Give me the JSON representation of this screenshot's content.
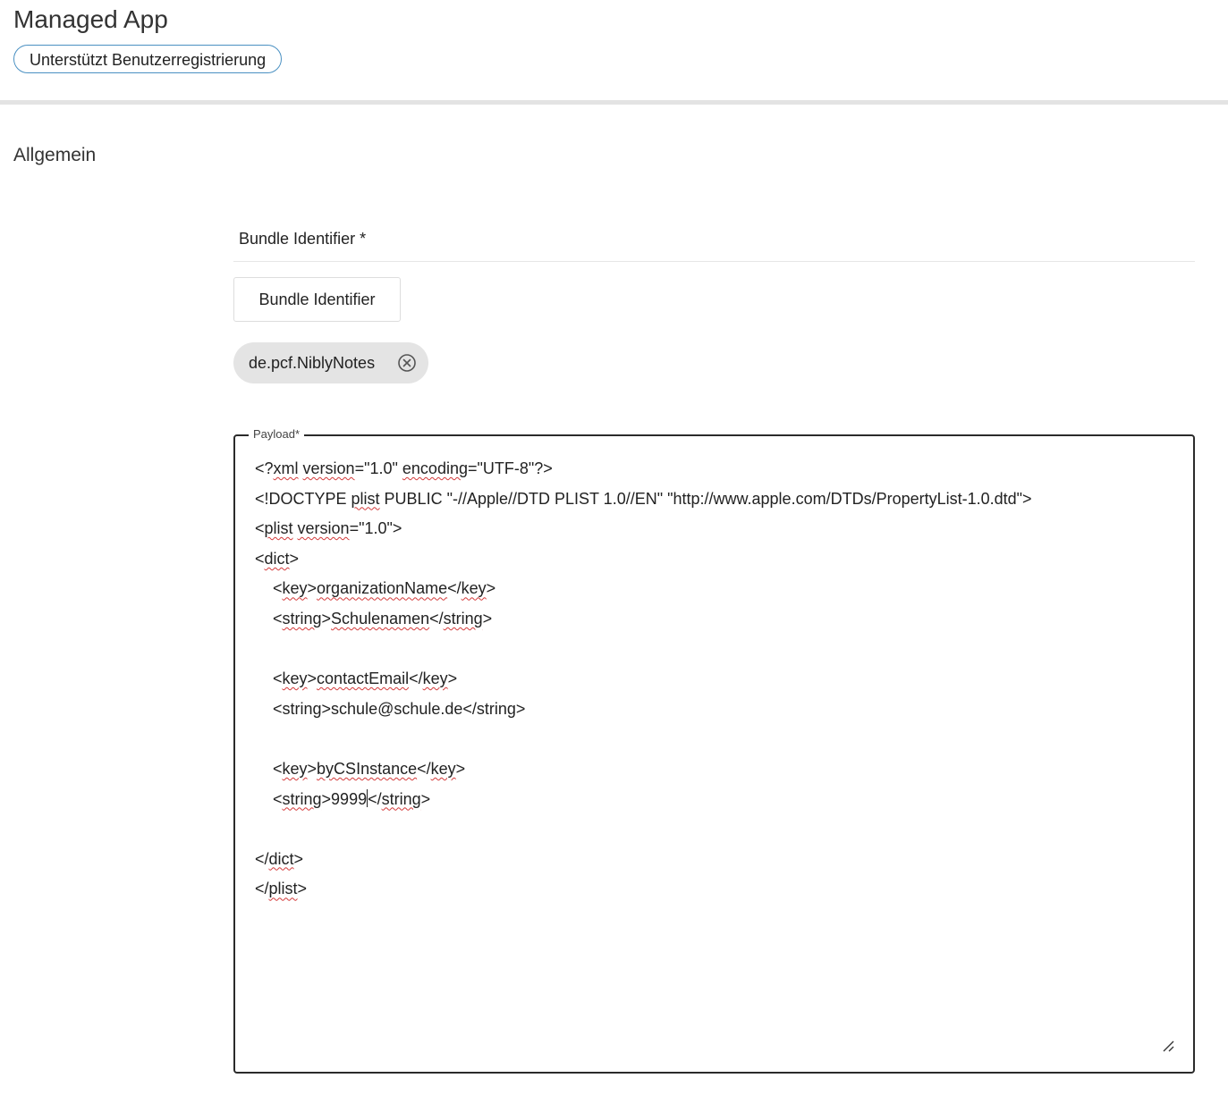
{
  "header": {
    "title": "Managed App",
    "badge": "Unterstützt Benutzerregistrierung"
  },
  "section": {
    "title": "Allgemein"
  },
  "bundle": {
    "field_label": "Bundle Identifier *",
    "button_label": "Bundle Identifier",
    "chip_label": "de.pcf.NiblyNotes"
  },
  "payload": {
    "legend": "Payload*",
    "lines": [
      [
        {
          "t": "<?"
        },
        {
          "t": "xml",
          "sq": true
        },
        {
          "t": " "
        },
        {
          "t": "version",
          "sq": true
        },
        {
          "t": "=\"1.0\" "
        },
        {
          "t": "encoding",
          "sq": true
        },
        {
          "t": "=\"UTF-8\"?>"
        }
      ],
      [
        {
          "t": "<!DOCTYPE "
        },
        {
          "t": "plist",
          "sq": true
        },
        {
          "t": " PUBLIC \"-//Apple//DTD PLIST 1.0//EN\" \"http://www.apple.com/DTDs/PropertyList-1.0.dtd\">"
        }
      ],
      [
        {
          "t": "<"
        },
        {
          "t": "plist",
          "sq": true
        },
        {
          "t": " "
        },
        {
          "t": "version",
          "sq": true
        },
        {
          "t": "=\"1.0\">"
        }
      ],
      [
        {
          "t": "<"
        },
        {
          "t": "dict",
          "sq": true
        },
        {
          "t": ">"
        }
      ],
      [
        {
          "t": "    <"
        },
        {
          "t": "key",
          "sq": true
        },
        {
          "t": ">"
        },
        {
          "t": "organizationName",
          "sq": true
        },
        {
          "t": "</"
        },
        {
          "t": "key",
          "sq": true
        },
        {
          "t": ">"
        }
      ],
      [
        {
          "t": "    <"
        },
        {
          "t": "string",
          "sq": true
        },
        {
          "t": ">"
        },
        {
          "t": "Schulenamen",
          "sq": true
        },
        {
          "t": "</"
        },
        {
          "t": "string",
          "sq": true
        },
        {
          "t": ">"
        }
      ],
      [],
      [
        {
          "t": "    <"
        },
        {
          "t": "key",
          "sq": true
        },
        {
          "t": ">"
        },
        {
          "t": "contactEmail",
          "sq": true
        },
        {
          "t": "</"
        },
        {
          "t": "key",
          "sq": true
        },
        {
          "t": ">"
        }
      ],
      [
        {
          "t": "    <string>schule@schule.de</string>"
        }
      ],
      [],
      [
        {
          "t": "    <"
        },
        {
          "t": "key",
          "sq": true
        },
        {
          "t": ">"
        },
        {
          "t": "byCSInstance",
          "sq": true
        },
        {
          "t": "</"
        },
        {
          "t": "key",
          "sq": true
        },
        {
          "t": ">"
        }
      ],
      [
        {
          "t": "    <"
        },
        {
          "t": "string",
          "sq": true
        },
        {
          "t": ">9999"
        },
        {
          "caret": true
        },
        {
          "t": "</"
        },
        {
          "t": "string",
          "sq": true
        },
        {
          "t": ">"
        }
      ],
      [],
      [
        {
          "t": "</"
        },
        {
          "t": "dict",
          "sq": true
        },
        {
          "t": ">"
        }
      ],
      [
        {
          "t": "</"
        },
        {
          "t": "plist",
          "sq": true
        },
        {
          "t": ">"
        }
      ]
    ]
  },
  "icons": {
    "chip_remove": "circle-x-icon",
    "resize": "resize-handle-icon"
  },
  "colors": {
    "badge_border": "#4a90c2",
    "chip_bg": "#e4e4e4",
    "spellcheck": "#d33a3a"
  }
}
